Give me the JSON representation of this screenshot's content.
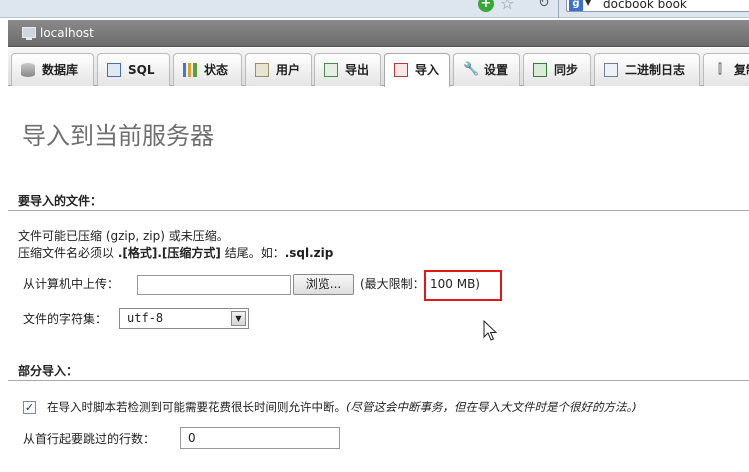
{
  "browser": {
    "search_text": "docbook book"
  },
  "server": {
    "label": "localhost"
  },
  "tabs": [
    {
      "label": "数据库",
      "icon": "database-icon"
    },
    {
      "label": "SQL",
      "icon": "sql-icon"
    },
    {
      "label": "状态",
      "icon": "status-chart-icon"
    },
    {
      "label": "用户",
      "icon": "users-icon"
    },
    {
      "label": "导出",
      "icon": "export-icon"
    },
    {
      "label": "导入",
      "icon": "import-icon"
    },
    {
      "label": "设置",
      "icon": "wrench-icon"
    },
    {
      "label": "同步",
      "icon": "sync-icon"
    },
    {
      "label": "二进制日志",
      "icon": "log-icon"
    },
    {
      "label": "复制",
      "icon": "replication-icon"
    }
  ],
  "active_tab": "导入",
  "page": {
    "title": "导入到当前服务器"
  },
  "file_section": {
    "title": "要导入的文件：",
    "compress_note": "文件可能已压缩 (gzip, zip) 或未压缩。",
    "name_note_prefix": "压缩文件名必须以 ",
    "name_note_format": ".[格式].[压缩方式]",
    "name_note_middle": " 结尾。如：",
    "name_note_example": ".sql.zip",
    "upload_label": "从计算机中上传：",
    "browse_label": "浏览...",
    "limit_prefix": "(最大限制：",
    "limit_value": "100 MB)",
    "charset_label": "文件的字符集：",
    "charset_value": "utf-8"
  },
  "partial_section": {
    "title": "部分导入：",
    "interrupt_label": "在导入时脚本若检测到可能需要花费很长时间则允许中断。",
    "interrupt_hint": "(尽管这会中断事务，但在导入大文件时是个很好的方法。)",
    "interrupt_checked": true,
    "skip_label": "从首行起要跳过的行数：",
    "skip_value": "0"
  },
  "colors": {
    "highlight_border": "#e01818",
    "server_bar": "#7a7a7a",
    "title_gray": "#6f6f6f"
  }
}
